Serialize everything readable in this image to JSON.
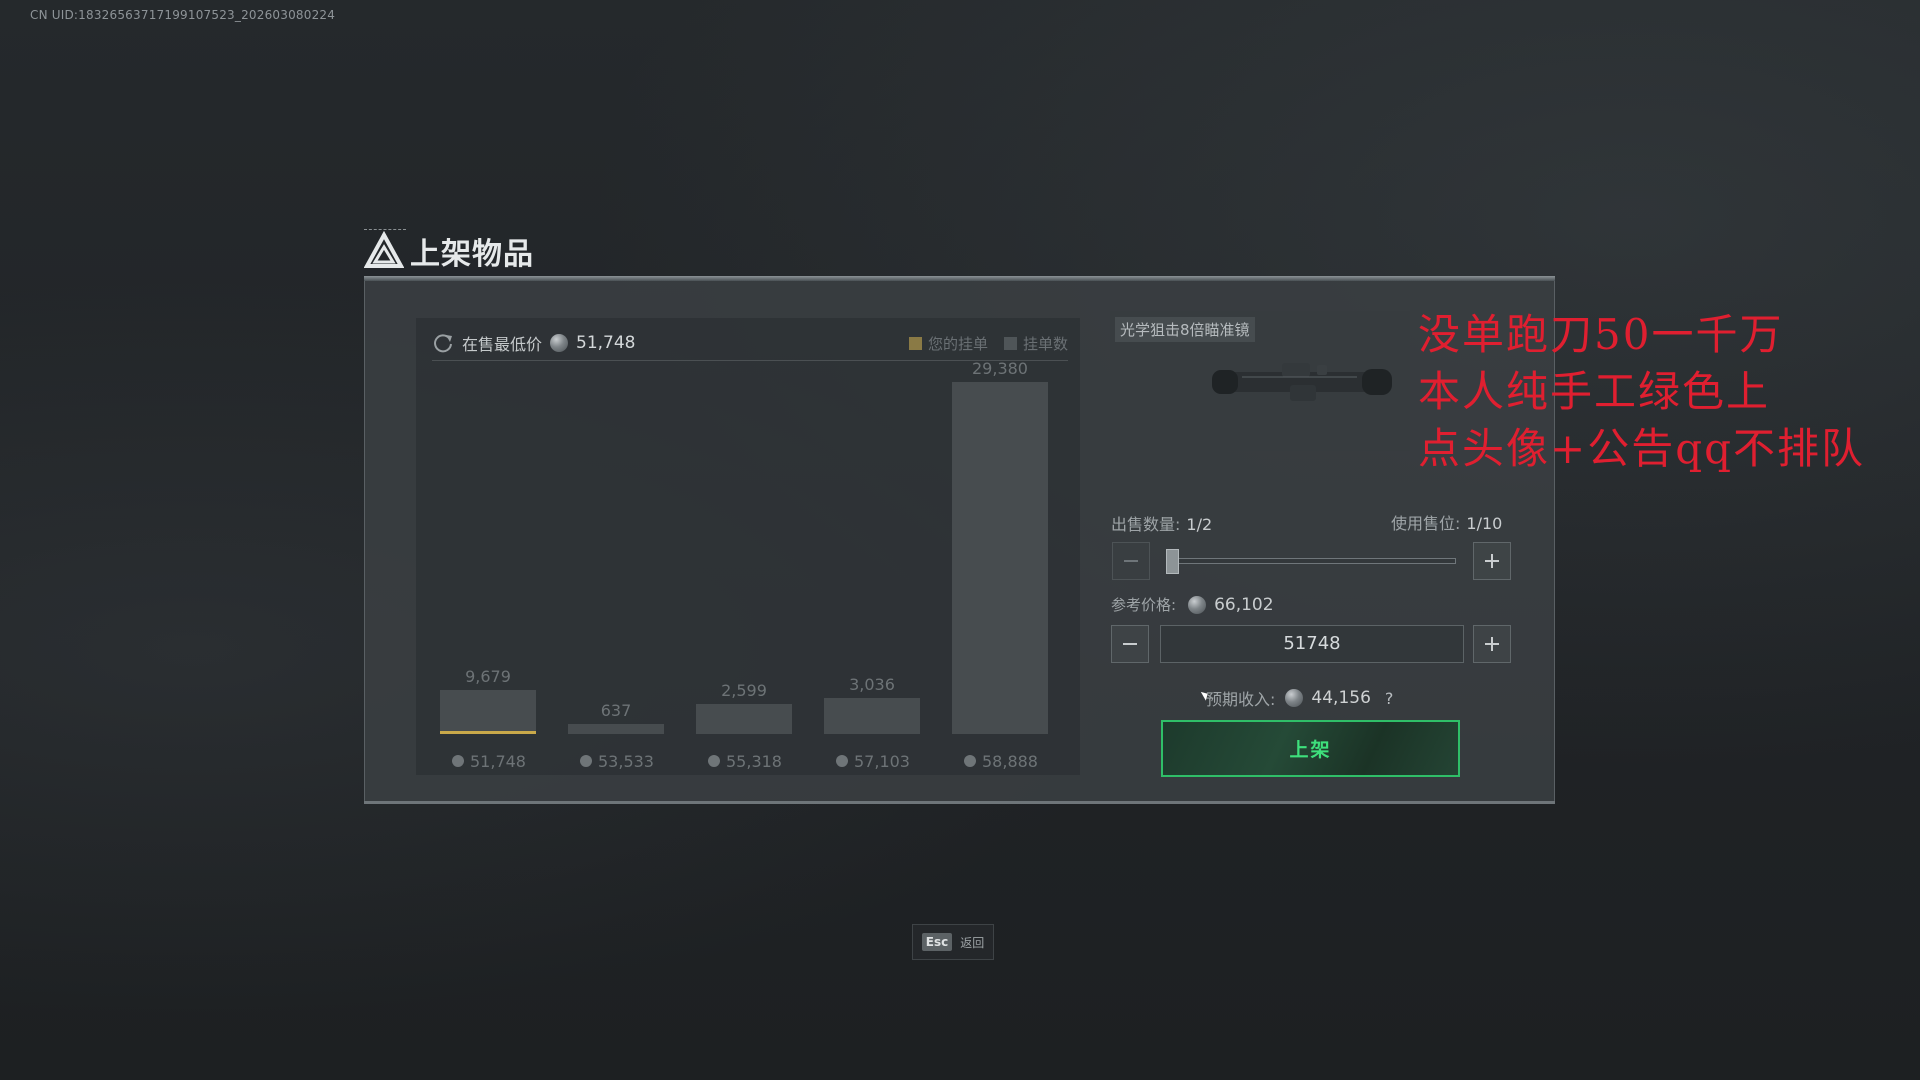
{
  "uid_text": "CN UID:18326563717199107523_202603080224",
  "dialog": {
    "title": "上架物品"
  },
  "chart_header": {
    "lowest_label": "在售最低价",
    "lowest_value": "51,748",
    "legend": [
      {
        "label": "您的挂单",
        "color": "#a08a4a"
      },
      {
        "label": "挂单数",
        "color": "#555b5e"
      }
    ]
  },
  "chart_data": {
    "type": "bar",
    "categories": [
      "51,748",
      "53,533",
      "55,318",
      "57,103",
      "58,888"
    ],
    "values": [
      9679,
      637,
      2599,
      3036,
      29380
    ],
    "data_labels": [
      "9,679",
      "637",
      "2,599",
      "3,036",
      "29,380"
    ],
    "highlight_index": 0,
    "highlight_color": "#c9a94a",
    "bar_color": "#474c4f",
    "ylim": [
      0,
      29380
    ]
  },
  "item": {
    "name": "光学狙击8倍瞄准镜"
  },
  "ad_overlay": {
    "lines": [
      "没单跑刀50一千万",
      "本人纯手工绿色上",
      "点头像+公告qq不排队"
    ],
    "color": "#e01f30"
  },
  "quantity": {
    "label": "出售数量:",
    "value": "1/2",
    "slots_label": "使用售位:",
    "slots_value": "1/10",
    "fill": 0.0
  },
  "price": {
    "ref_label": "参考价格:",
    "ref_value": "66,102",
    "input_value": "51748"
  },
  "income": {
    "label": "预期收入:",
    "value": "44,156",
    "help": "?"
  },
  "submit_label": "上架",
  "esc": {
    "key": "Esc",
    "label": "返回"
  }
}
